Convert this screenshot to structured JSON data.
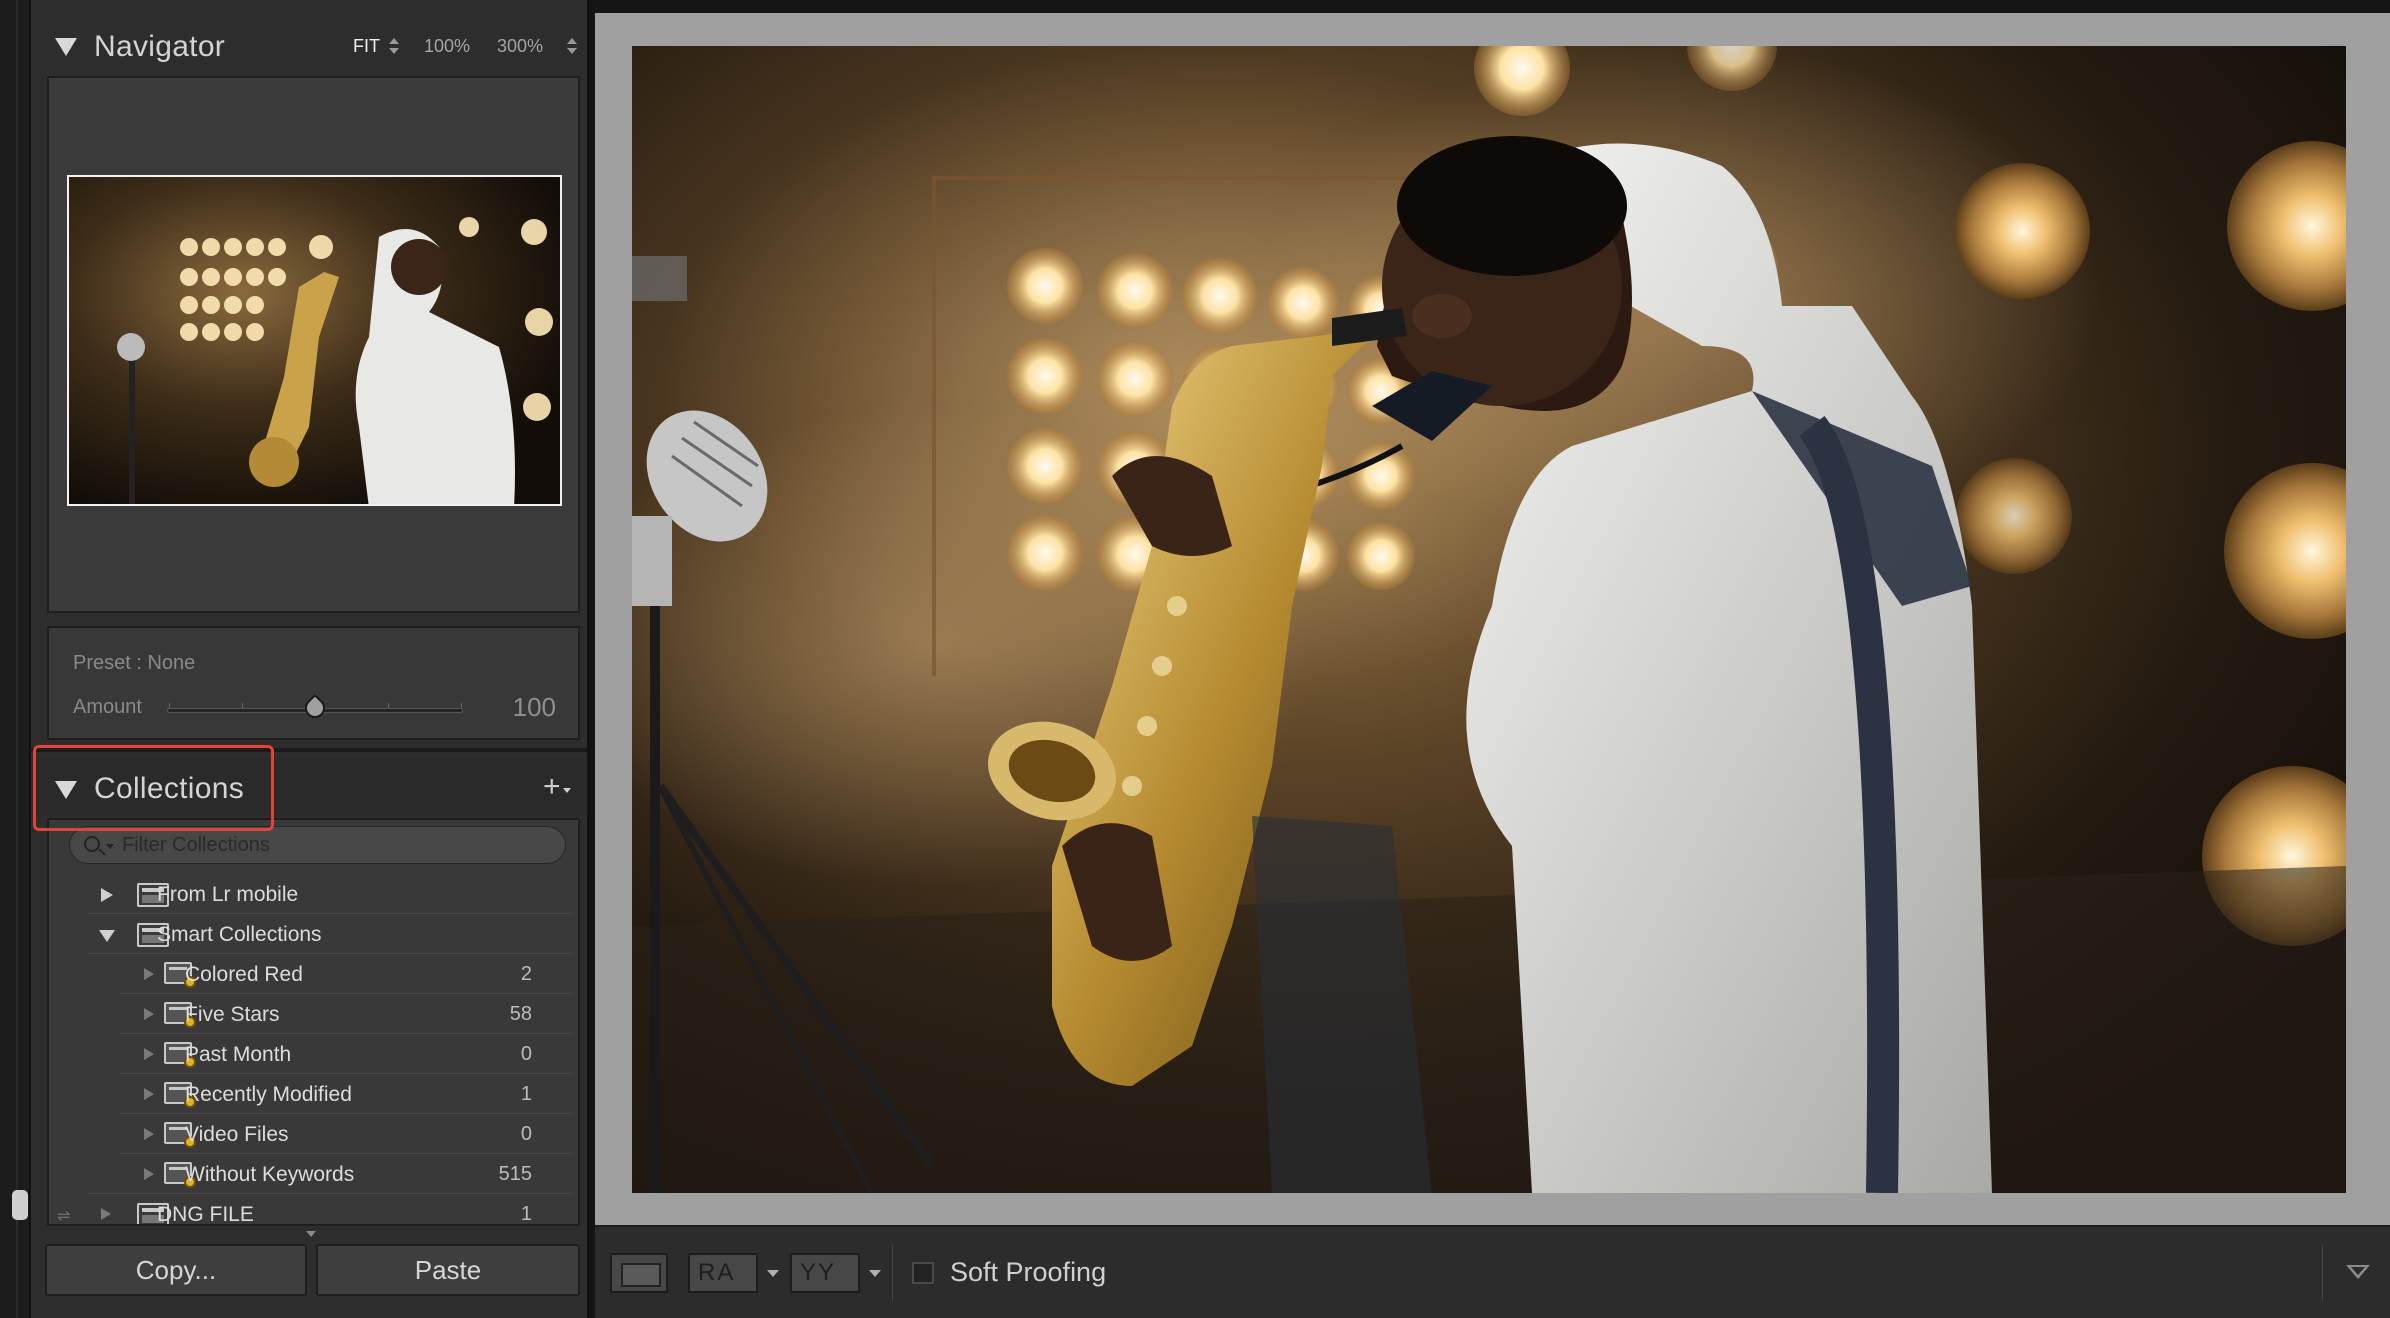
{
  "navigator": {
    "title": "Navigator",
    "zoom_options": [
      "FIT",
      "100%",
      "300%"
    ],
    "active_zoom": "FIT"
  },
  "preset": {
    "label": "Preset : None",
    "amount_label": "Amount",
    "amount_value": "100",
    "amount_fraction": 0.5
  },
  "collections": {
    "title": "Collections",
    "filter_placeholder": "Filter Collections",
    "items": [
      {
        "label": "From Lr mobile",
        "type": "set",
        "expanded": false
      },
      {
        "label": "Smart Collections",
        "type": "set",
        "expanded": true
      },
      {
        "label": "Colored Red",
        "count": "2",
        "type": "smart"
      },
      {
        "label": "Five Stars",
        "count": "58",
        "type": "smart"
      },
      {
        "label": "Past Month",
        "count": "0",
        "type": "smart"
      },
      {
        "label": "Recently Modified",
        "count": "1",
        "type": "smart"
      },
      {
        "label": "Video Files",
        "count": "0",
        "type": "smart"
      },
      {
        "label": "Without Keywords",
        "count": "515",
        "type": "smart"
      },
      {
        "label": "DNG FILE",
        "count": "1",
        "type": "set"
      }
    ]
  },
  "buttons": {
    "copy": "Copy...",
    "paste": "Paste"
  },
  "toolbar": {
    "soft_proofing_label": "Soft Proofing",
    "soft_proofing_checked": false,
    "compare_glyph_ra": "RA",
    "compare_glyph_yy": "YY"
  },
  "colors": {
    "highlight": "#e0443a",
    "panel_bg": "#2d2d2d",
    "main_bg": "#a0a0a0"
  },
  "icons": [
    "panel-collapse-icon",
    "plus-icon",
    "search-icon",
    "collection-set-icon",
    "smart-collection-icon",
    "sync-icon",
    "loupe-view-icon",
    "before-after-icon",
    "panel-menu-icon"
  ]
}
